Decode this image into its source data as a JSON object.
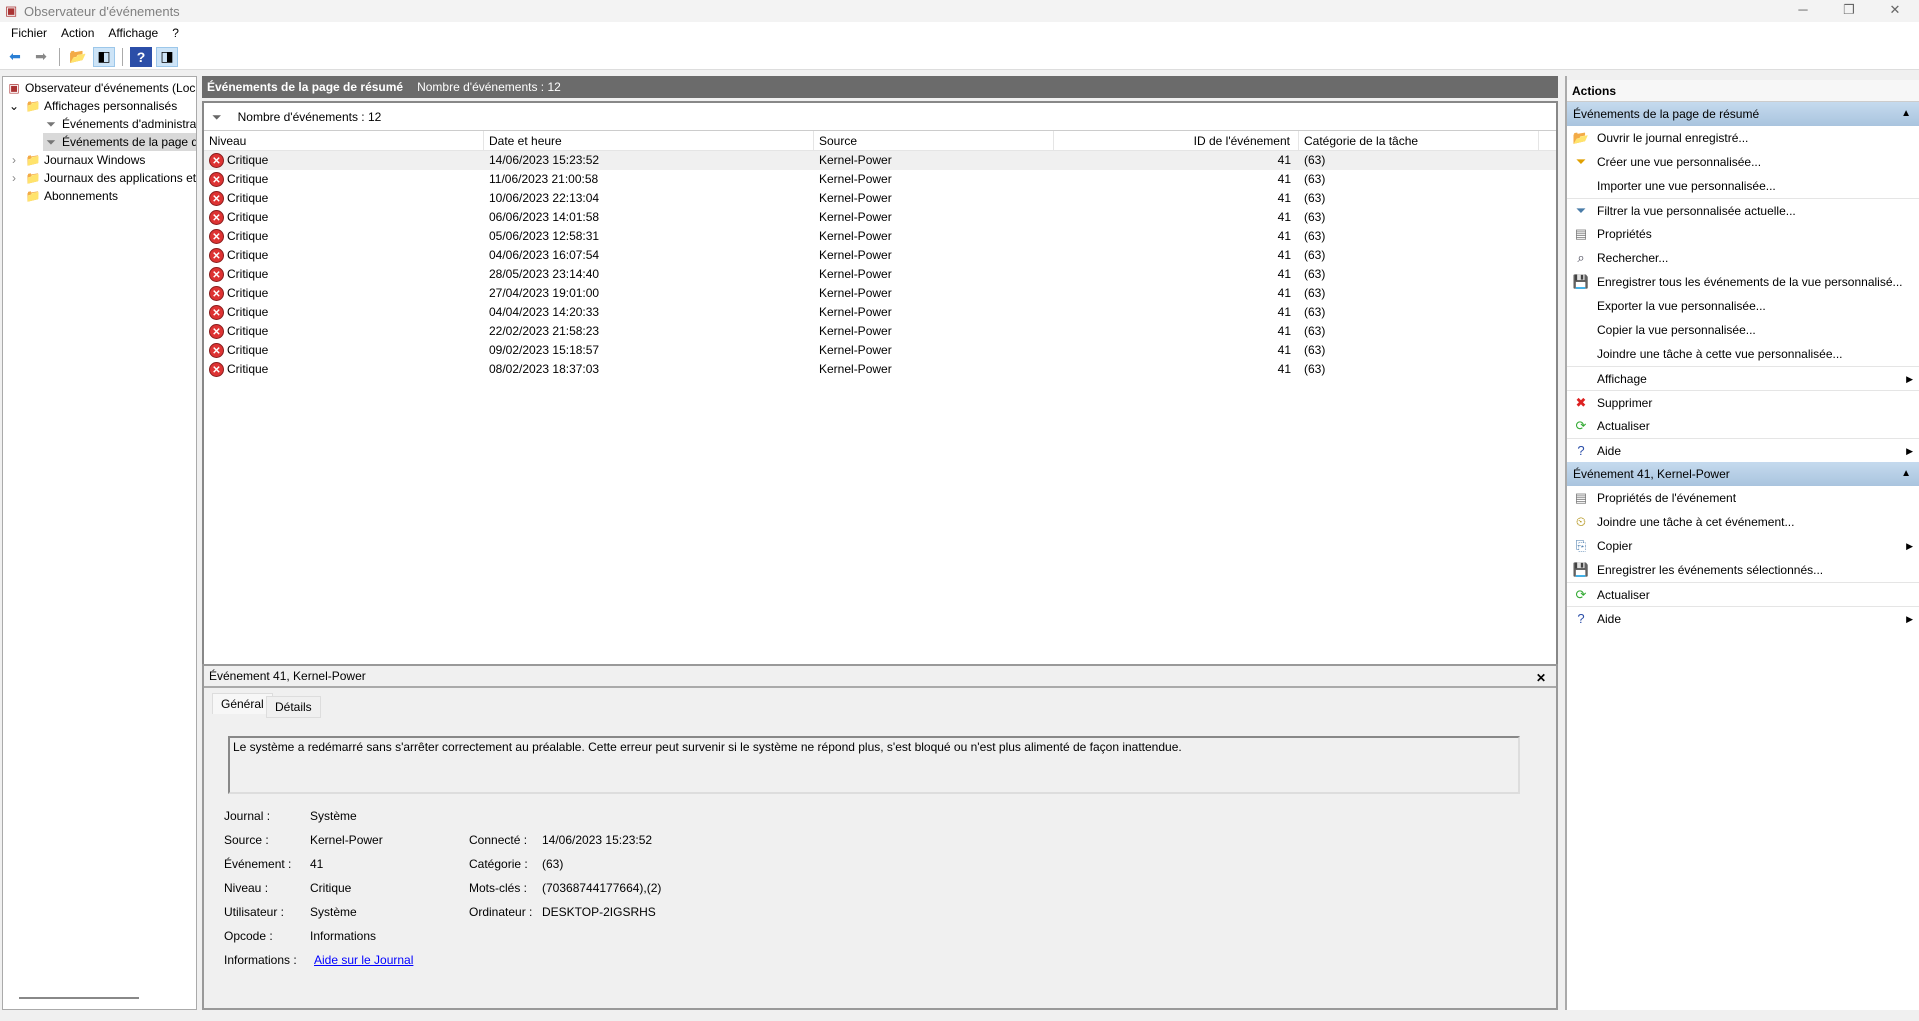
{
  "window": {
    "title": "Observateur d'événements",
    "min": "─",
    "restore": "❐",
    "close": "✕"
  },
  "menu": [
    "Fichier",
    "Action",
    "Affichage",
    "?"
  ],
  "tree": {
    "root": "Observateur d'événements (Local)",
    "custom": "Affichages personnalisés",
    "admin": "Événements d'administration",
    "summary": "Événements de la page de résumé",
    "windows": "Journaux Windows",
    "apps": "Journaux des applications et de services",
    "subs": "Abonnements"
  },
  "center": {
    "title": "Événements de la page de résumé",
    "count": "Nombre d'événements : 12",
    "filter_count": "Nombre d'événements : 12",
    "columns": [
      "Niveau",
      "Date et heure",
      "Source",
      "ID de l'événement",
      "Catégorie de la tâche"
    ],
    "rows": [
      {
        "level": "Critique",
        "date": "14/06/2023 15:23:52",
        "source": "Kernel-Power",
        "id": "41",
        "cat": "(63)"
      },
      {
        "level": "Critique",
        "date": "11/06/2023 21:00:58",
        "source": "Kernel-Power",
        "id": "41",
        "cat": "(63)"
      },
      {
        "level": "Critique",
        "date": "10/06/2023 22:13:04",
        "source": "Kernel-Power",
        "id": "41",
        "cat": "(63)"
      },
      {
        "level": "Critique",
        "date": "06/06/2023 14:01:58",
        "source": "Kernel-Power",
        "id": "41",
        "cat": "(63)"
      },
      {
        "level": "Critique",
        "date": "05/06/2023 12:58:31",
        "source": "Kernel-Power",
        "id": "41",
        "cat": "(63)"
      },
      {
        "level": "Critique",
        "date": "04/06/2023 16:07:54",
        "source": "Kernel-Power",
        "id": "41",
        "cat": "(63)"
      },
      {
        "level": "Critique",
        "date": "28/05/2023 23:14:40",
        "source": "Kernel-Power",
        "id": "41",
        "cat": "(63)"
      },
      {
        "level": "Critique",
        "date": "27/04/2023 19:01:00",
        "source": "Kernel-Power",
        "id": "41",
        "cat": "(63)"
      },
      {
        "level": "Critique",
        "date": "04/04/2023 14:20:33",
        "source": "Kernel-Power",
        "id": "41",
        "cat": "(63)"
      },
      {
        "level": "Critique",
        "date": "22/02/2023 21:58:23",
        "source": "Kernel-Power",
        "id": "41",
        "cat": "(63)"
      },
      {
        "level": "Critique",
        "date": "09/02/2023 15:18:57",
        "source": "Kernel-Power",
        "id": "41",
        "cat": "(63)"
      },
      {
        "level": "Critique",
        "date": "08/02/2023 18:37:03",
        "source": "Kernel-Power",
        "id": "41",
        "cat": "(63)"
      }
    ]
  },
  "detail": {
    "title": "Événement 41, Kernel-Power",
    "close": "✕",
    "tabs": [
      "Général",
      "Détails"
    ],
    "message": "Le système a redémarré sans s'arrêter correctement au préalable. Cette erreur peut survenir si le système ne répond plus, s'est bloqué ou n'est plus alimenté de façon inattendue.",
    "left": [
      [
        "Journal :",
        "Système"
      ],
      [
        "Source :",
        "Kernel-Power"
      ],
      [
        "Événement :",
        "41"
      ],
      [
        "Niveau :",
        "Critique"
      ],
      [
        "Utilisateur :",
        "Système"
      ],
      [
        "Opcode :",
        "Informations"
      ],
      [
        "Informations :",
        "Aide sur le Journal"
      ]
    ],
    "right": [
      [
        "Connecté :",
        "14/06/2023 15:23:52"
      ],
      [
        "Catégorie :",
        "(63)"
      ],
      [
        "Mots-clés :",
        "(70368744177664),(2)"
      ],
      [
        "Ordinateur :",
        "DESKTOP-2IGSRHS"
      ]
    ]
  },
  "actions": {
    "title": "Actions",
    "sec1": "Événements de la page de résumé",
    "items1": [
      "Ouvrir le journal enregistré...",
      "Créer une vue personnalisée...",
      "Importer une vue personnalisée...",
      "Filtrer la vue personnalisée actuelle...",
      "Propriétés",
      "Rechercher...",
      "Enregistrer tous les événements de la vue personnalisé...",
      "Exporter la vue personnalisée...",
      "Copier la vue personnalisée...",
      "Joindre une tâche à cette vue personnalisée...",
      "Affichage",
      "Supprimer",
      "Actualiser",
      "Aide"
    ],
    "sec2": "Événement 41, Kernel-Power",
    "items2": [
      "Propriétés de l'événement",
      "Joindre une tâche à cet événement...",
      "Copier",
      "Enregistrer les événements sélectionnés...",
      "Actualiser",
      "Aide"
    ]
  }
}
